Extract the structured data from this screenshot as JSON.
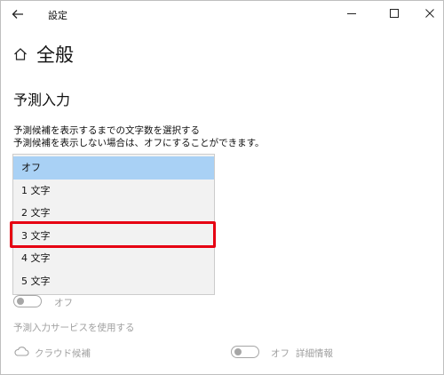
{
  "window": {
    "title": "設定"
  },
  "header": {
    "title": "全般"
  },
  "section": {
    "title": "予測入力",
    "description_line1": "予測候補を表示するまでの文字数を選択する",
    "description_line2": "予測候補を表示しない場合は、オフにすることができます。"
  },
  "dropdown": {
    "selected": "オフ",
    "options": [
      "オフ",
      "1 文字",
      "2 文字",
      "3 文字",
      "4 文字",
      "5 文字"
    ]
  },
  "toggle1": {
    "state_label": "オフ",
    "on": false
  },
  "services": {
    "label": "予測入力サービスを使用する",
    "cloud_label": "クラウド候補",
    "cloud_state_label": "オフ",
    "cloud_on": false,
    "details_label": "詳細情報"
  },
  "colors": {
    "selected_option": "#a9d1f5",
    "highlight_border": "#e60012",
    "dropdown_bg": "#f2f2f2",
    "disabled_text": "#a0a0a0"
  }
}
